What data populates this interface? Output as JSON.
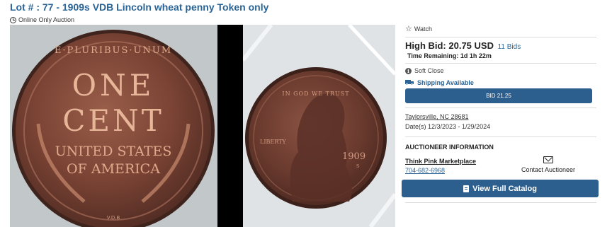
{
  "lot": {
    "title": "Lot # : 77 - 1909s VDB Lincoln wheat penny Token only",
    "auction_type": "Online Only Auction"
  },
  "photos": {
    "left": {
      "coin_text_top": "E·PLURIBUS·UNUM",
      "coin_text_one": "ONE",
      "coin_text_cent": "CENT",
      "coin_text_united": "UNITED STATES",
      "coin_text_america": "OF AMERICA",
      "coin_text_vdb": "V.D.B"
    },
    "right": {
      "coin_text_top": "IN GOD WE TRUST",
      "coin_text_liberty": "LIBERTY",
      "coin_text_year": "1909",
      "coin_text_mint": "S"
    }
  },
  "bidding": {
    "watch_label": "Watch",
    "high_bid_label": "High Bid: 20.75 USD",
    "bids_count": "11 Bids",
    "time_remaining": "Time Remaining: 1d 1h 22m",
    "soft_close": "Soft Close",
    "shipping": "Shipping Available",
    "bid_button": "BID 21.25"
  },
  "details": {
    "location": "Taylorsville, NC 28681",
    "dates": "Date(s) 12/3/2023 - 1/29/2024"
  },
  "auctioneer": {
    "heading": "AUCTIONEER INFORMATION",
    "name": "Think Pink Marketplace",
    "phone": "704-682-6968",
    "contact_label": "Contact Auctioneer"
  },
  "catalog": {
    "button_label": "View Full Catalog"
  },
  "colors": {
    "accent": "#2a6496",
    "button": "#2c5f8e",
    "copper": "#8a4a38"
  }
}
